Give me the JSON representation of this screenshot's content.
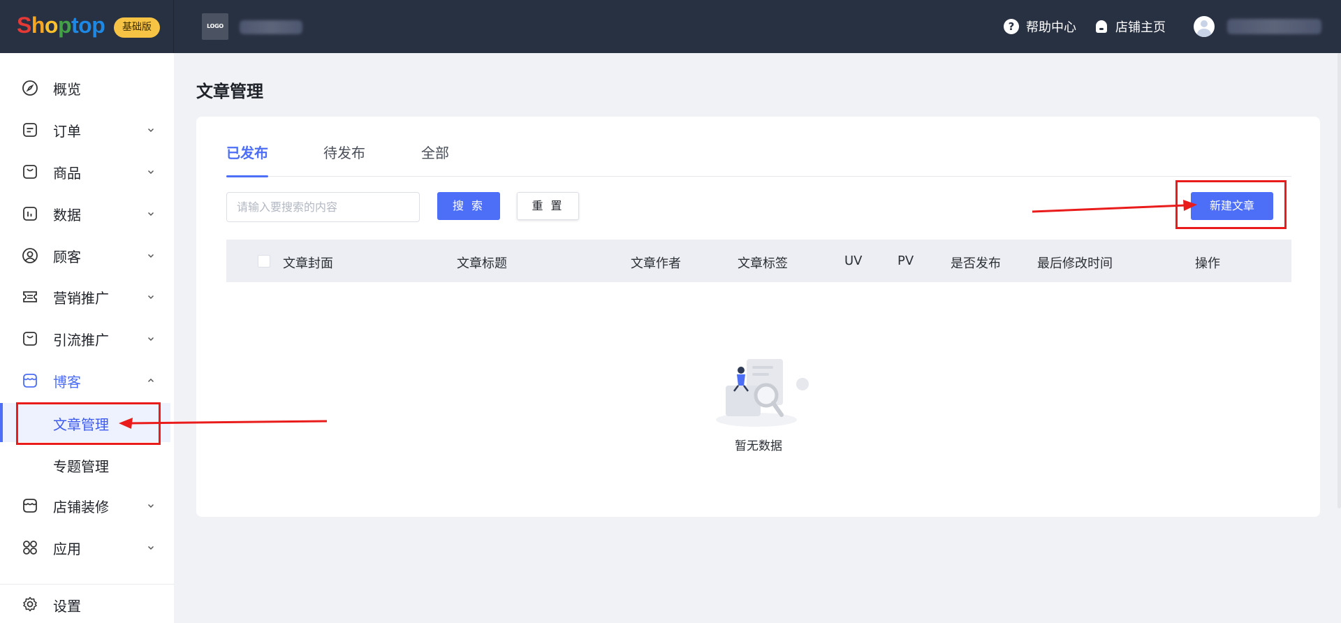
{
  "topbar": {
    "brand_letters": [
      "S",
      "h",
      "o",
      "p",
      "t",
      "o",
      "p"
    ],
    "edition_badge": "基础版",
    "store_logo_text": "LOGO",
    "help_label": "帮助中心",
    "shop_home_label": "店铺主页"
  },
  "sidebar": {
    "items": [
      {
        "key": "overview",
        "label": "概览",
        "icon": "compass-icon"
      },
      {
        "key": "orders",
        "label": "订单",
        "icon": "order-icon"
      },
      {
        "key": "products",
        "label": "商品",
        "icon": "bag-icon"
      },
      {
        "key": "data",
        "label": "数据",
        "icon": "chart-icon"
      },
      {
        "key": "customers",
        "label": "顾客",
        "icon": "user-circle-icon"
      },
      {
        "key": "marketing",
        "label": "营销推广",
        "icon": "ticket-icon"
      },
      {
        "key": "traffic",
        "label": "引流推广",
        "icon": "bag-icon"
      },
      {
        "key": "blog",
        "label": "博客",
        "icon": "store-icon"
      },
      {
        "key": "store-design",
        "label": "店铺装修",
        "icon": "store-icon"
      },
      {
        "key": "apps",
        "label": "应用",
        "icon": "apps-icon"
      }
    ],
    "blog_sub_items": [
      "文章管理",
      "专题管理"
    ],
    "settings_label": "设置"
  },
  "main": {
    "page_title": "文章管理",
    "tabs": [
      "已发布",
      "待发布",
      "全部"
    ],
    "search": {
      "placeholder": "请输入要搜索的内容",
      "value": ""
    },
    "search_button": "搜 索",
    "reset_button": "重 置",
    "new_article_button": "新建文章",
    "table_columns": [
      "文章封面",
      "文章标题",
      "文章作者",
      "文章标签",
      "UV",
      "PV",
      "是否发布",
      "最后修改时间",
      "操作"
    ],
    "empty_text": "暂无数据"
  },
  "colors": {
    "topbar_bg": "#283142",
    "accent": "#4d6ef6",
    "badge": "#f6c344",
    "annotation": "#ea1b1b"
  }
}
